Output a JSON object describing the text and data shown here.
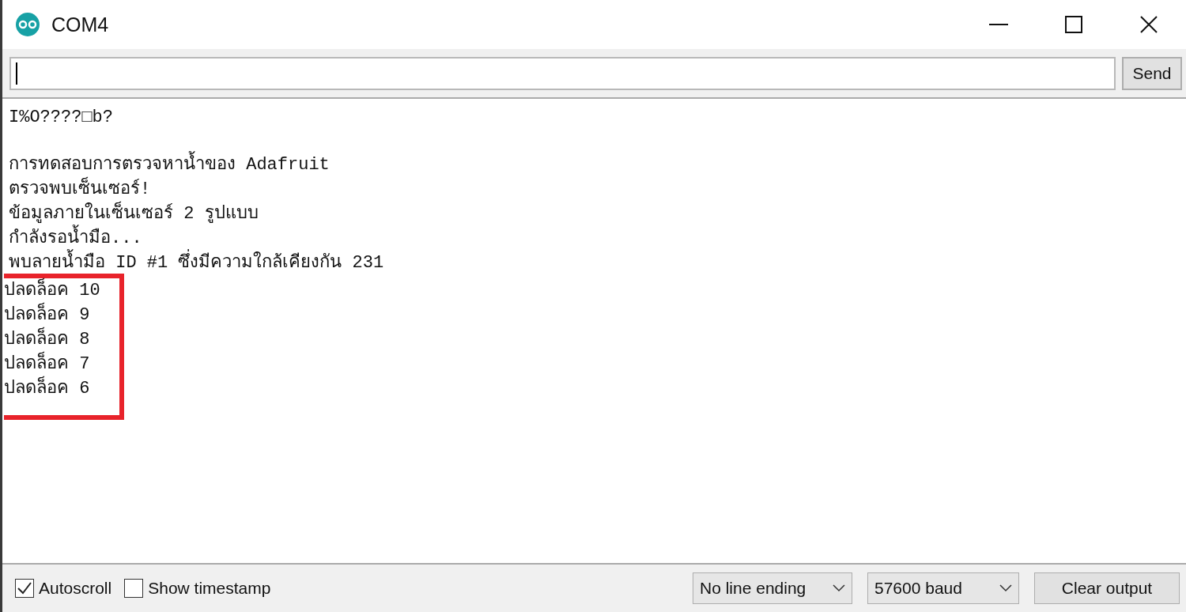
{
  "window": {
    "title": "COM4"
  },
  "input": {
    "send_label": "Send"
  },
  "output": {
    "banner": "I%O????□b?",
    "lines": [
      "การทดสอบการตรวจหาน้ำของ Adafruit",
      "ตรวจพบเซ็นเซอร์!",
      "ข้อมูลภายในเซ็นเซอร์ 2 รูปแบบ",
      "กำลังรอน้ำมือ...",
      "พบลายน้ำมือ ID #1 ซึ่งมีความใกล้เคียงกัน 231"
    ],
    "highlighted_lines": [
      "ปลดล็อค 10",
      "ปลดล็อค 9",
      "ปลดล็อค 8",
      "ปลดล็อค 7",
      "ปลดล็อค 6"
    ]
  },
  "status_bar": {
    "checkboxes": [
      {
        "label": "Autoscroll",
        "checked": true
      },
      {
        "label": "Show timestamp",
        "checked": false
      }
    ],
    "dropdowns": [
      "No line ending",
      "57600 baud"
    ],
    "clear_button": "Clear output"
  }
}
